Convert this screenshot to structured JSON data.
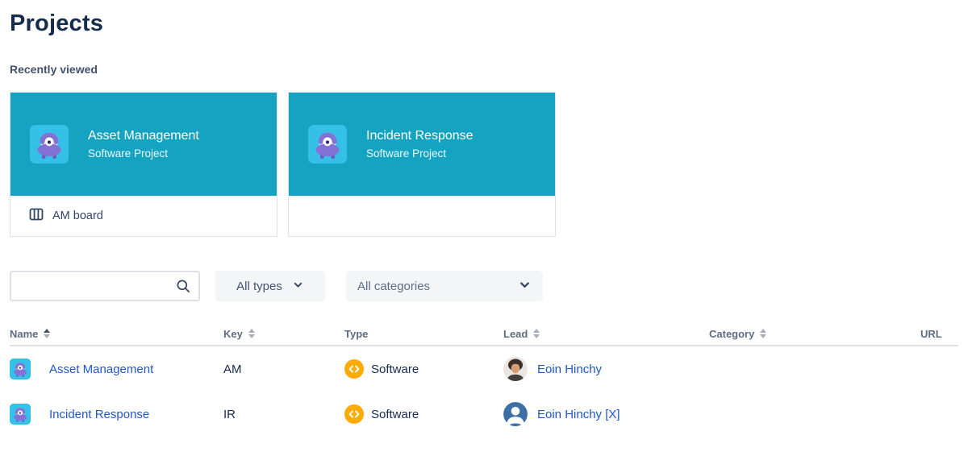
{
  "page": {
    "title": "Projects",
    "recently_viewed_label": "Recently viewed"
  },
  "cards": [
    {
      "title": "Asset Management",
      "subtitle": "Software Project",
      "board_link_label": "AM board"
    },
    {
      "title": "Incident Response",
      "subtitle": "Software Project"
    }
  ],
  "filters": {
    "search_value": "",
    "type_dropdown_label": "All types",
    "category_dropdown_label": "All categories"
  },
  "table": {
    "columns": [
      {
        "label": "Name",
        "sort": "ascending"
      },
      {
        "label": "Key",
        "sort": "sortable"
      },
      {
        "label": "Type",
        "sort": "none"
      },
      {
        "label": "Lead",
        "sort": "sortable"
      },
      {
        "label": "Category",
        "sort": "sortable"
      },
      {
        "label": "URL",
        "sort": "none"
      }
    ],
    "rows": [
      {
        "name": "Asset Management",
        "key": "AM",
        "type": "Software",
        "lead": "Eoin Hinchy",
        "category": "",
        "url": ""
      },
      {
        "name": "Incident Response",
        "key": "IR",
        "type": "Software",
        "lead": "Eoin Hinchy [X]",
        "category": "",
        "url": ""
      }
    ]
  },
  "icons": {
    "search": "magnifier",
    "board": "board-columns",
    "type_software": "code-brackets",
    "sort": "up-down-triangles",
    "dropdown": "chevron-down",
    "project_avatar": "jira-monster-avatar",
    "lead_row2_avatar": "generic-person"
  },
  "colors": {
    "card_header_teal": "#14A4C2",
    "project_avatar_cyan": "#35C0E8",
    "project_avatar_purple": "#8272D4",
    "link_blue": "#2156CF",
    "type_icon_yellow": "#FFAB00",
    "lead_avatar_blue": "#3C6FA5",
    "heading_navy": "#172B4D"
  }
}
